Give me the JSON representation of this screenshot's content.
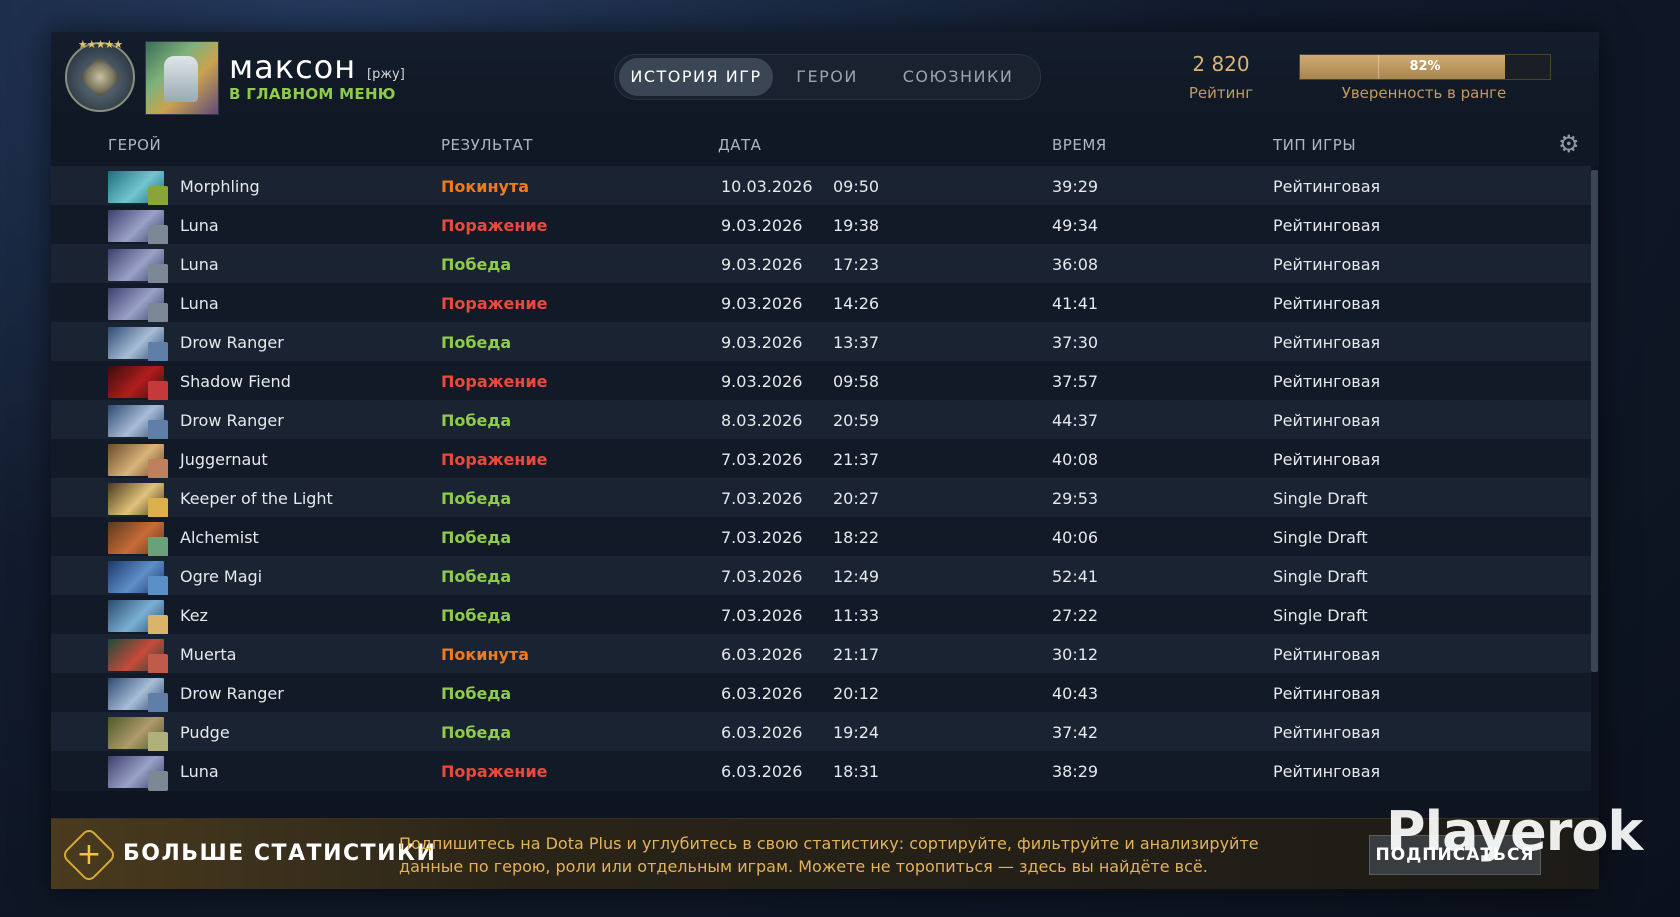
{
  "header": {
    "player_name": "максон",
    "player_tag": "[ржу]",
    "status": "В ГЛАВНОМ МЕНЮ",
    "tabs": [
      {
        "label": "ИСТОРИЯ ИГР",
        "active": true
      },
      {
        "label": "ГЕРОИ",
        "active": false
      },
      {
        "label": "СОЮЗНИКИ",
        "active": false
      }
    ],
    "rating_value": "2 820",
    "rating_label": "Рейтинг",
    "confidence_value": "82%",
    "confidence_percent": 82,
    "confidence_label": "Уверенность в ранге"
  },
  "columns": {
    "hero": "ГЕРОЙ",
    "result": "РЕЗУЛЬТАТ",
    "date": "ДАТА",
    "duration": "ВРЕМЯ",
    "mode": "ТИП ИГРЫ"
  },
  "colors": {
    "win": "#8ecb4b",
    "loss": "#ea4a3b",
    "abandon": "#f07a1e",
    "accent": "#c59a5b"
  },
  "matches": [
    {
      "hero": "Morphling",
      "result": "Покинута",
      "outcome": "abandon",
      "date": "10.03.2026",
      "time": "09:50",
      "duration": "39:29",
      "mode": "Рейтинговая"
    },
    {
      "hero": "Luna",
      "result": "Поражение",
      "outcome": "loss",
      "date": "9.03.2026",
      "time": "19:38",
      "duration": "49:34",
      "mode": "Рейтинговая"
    },
    {
      "hero": "Luna",
      "result": "Победа",
      "outcome": "win",
      "date": "9.03.2026",
      "time": "17:23",
      "duration": "36:08",
      "mode": "Рейтинговая"
    },
    {
      "hero": "Luna",
      "result": "Поражение",
      "outcome": "loss",
      "date": "9.03.2026",
      "time": "14:26",
      "duration": "41:41",
      "mode": "Рейтинговая"
    },
    {
      "hero": "Drow Ranger",
      "result": "Победа",
      "outcome": "win",
      "date": "9.03.2026",
      "time": "13:37",
      "duration": "37:30",
      "mode": "Рейтинговая"
    },
    {
      "hero": "Shadow Fiend",
      "result": "Поражение",
      "outcome": "loss",
      "date": "9.03.2026",
      "time": "09:58",
      "duration": "37:57",
      "mode": "Рейтинговая"
    },
    {
      "hero": "Drow Ranger",
      "result": "Победа",
      "outcome": "win",
      "date": "8.03.2026",
      "time": "20:59",
      "duration": "44:37",
      "mode": "Рейтинговая"
    },
    {
      "hero": "Juggernaut",
      "result": "Поражение",
      "outcome": "loss",
      "date": "7.03.2026",
      "time": "21:37",
      "duration": "40:08",
      "mode": "Рейтинговая"
    },
    {
      "hero": "Keeper of the Light",
      "result": "Победа",
      "outcome": "win",
      "date": "7.03.2026",
      "time": "20:27",
      "duration": "29:53",
      "mode": "Single Draft"
    },
    {
      "hero": "Alchemist",
      "result": "Победа",
      "outcome": "win",
      "date": "7.03.2026",
      "time": "18:22",
      "duration": "40:06",
      "mode": "Single Draft"
    },
    {
      "hero": "Ogre Magi",
      "result": "Победа",
      "outcome": "win",
      "date": "7.03.2026",
      "time": "12:49",
      "duration": "52:41",
      "mode": "Single Draft"
    },
    {
      "hero": "Kez",
      "result": "Победа",
      "outcome": "win",
      "date": "7.03.2026",
      "time": "11:33",
      "duration": "27:22",
      "mode": "Single Draft"
    },
    {
      "hero": "Muerta",
      "result": "Покинута",
      "outcome": "abandon",
      "date": "6.03.2026",
      "time": "21:17",
      "duration": "30:12",
      "mode": "Рейтинговая"
    },
    {
      "hero": "Drow Ranger",
      "result": "Победа",
      "outcome": "win",
      "date": "6.03.2026",
      "time": "20:12",
      "duration": "40:43",
      "mode": "Рейтинговая"
    },
    {
      "hero": "Pudge",
      "result": "Победа",
      "outcome": "win",
      "date": "6.03.2026",
      "time": "19:24",
      "duration": "37:42",
      "mode": "Рейтинговая"
    },
    {
      "hero": "Luna",
      "result": "Поражение",
      "outcome": "loss",
      "date": "6.03.2026",
      "time": "18:31",
      "duration": "38:29",
      "mode": "Рейтинговая"
    }
  ],
  "banner": {
    "title": "БОЛЬШЕ СТАТИСТИКИ",
    "text": "Подпишитесь на Dota Plus и углубитесь в свою статистику: сортируйте, фильтруйте и анализируйте данные по герою, роли или отдельным играм. Можете не торопиться — здесь вы найдёте всё.",
    "button_label": "ПОДПИСАТЬСЯ"
  },
  "watermark": "Playerok"
}
